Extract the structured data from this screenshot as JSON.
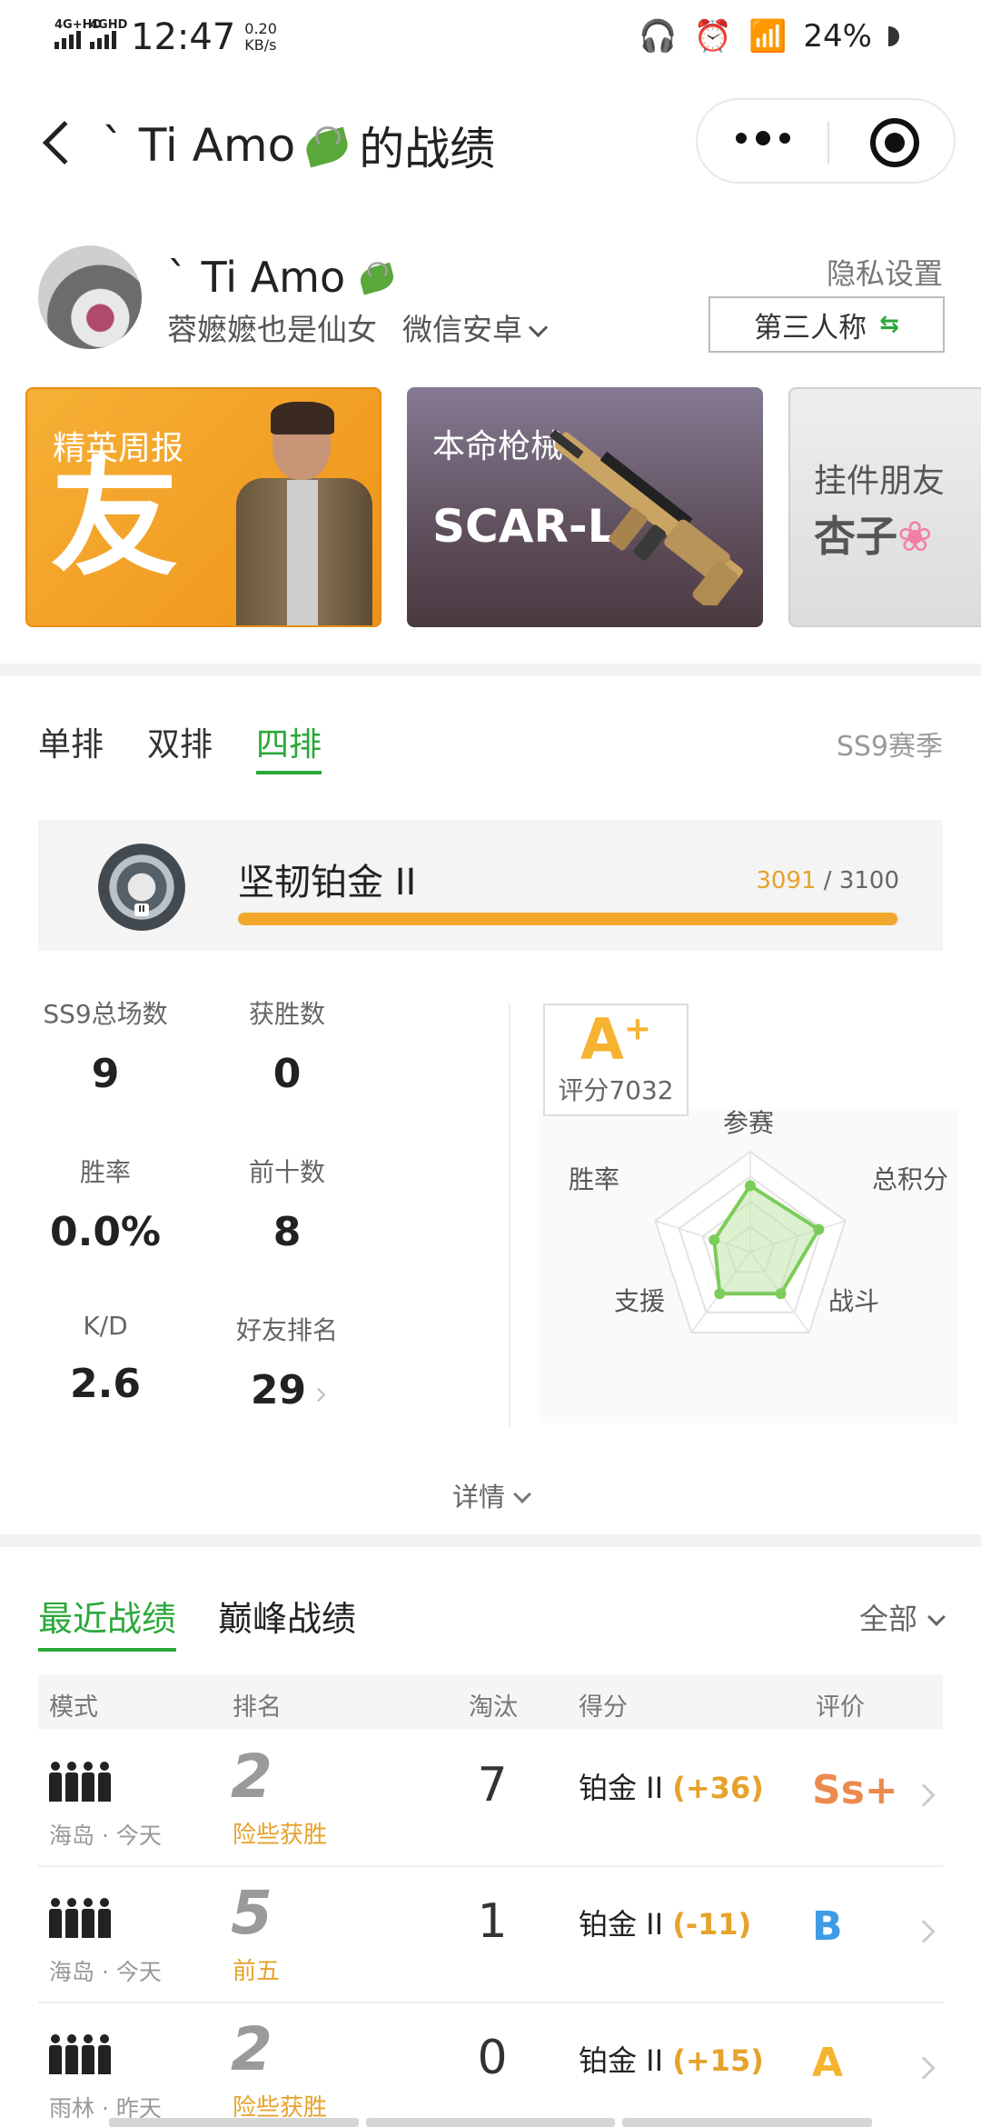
{
  "status_bar": {
    "network1": "4G+HD",
    "network2": "4GHD",
    "time": "12:47",
    "speed_value": "0.20",
    "speed_unit": "KB/s",
    "battery": "24%"
  },
  "nav": {
    "title": "` Ti Amo",
    "title_suffix": "的战绩"
  },
  "profile": {
    "name": "` Ti Amo",
    "signature": "蓉嬷嬷也是仙女",
    "platform": "微信安卓",
    "privacy_label": "隐私设置",
    "view_button": "第三人称"
  },
  "cards": [
    {
      "title": "精英周报",
      "value": "友"
    },
    {
      "title": "本命枪械",
      "value": "SCAR-L"
    },
    {
      "title": "挂件朋友",
      "value": "杏子"
    }
  ],
  "mode_tabs": [
    "单排",
    "双排",
    "四排"
  ],
  "active_mode": "四排",
  "season": "SS9赛季",
  "rank": {
    "name": "坚韧铂金 II",
    "current": "3091",
    "sep": " / ",
    "target": "3100",
    "progress": 0.997
  },
  "stats": [
    {
      "label": "SS9总场数",
      "value": "9"
    },
    {
      "label": "获胜数",
      "value": "0"
    },
    {
      "label": "胜率",
      "value": "0.0%"
    },
    {
      "label": "前十数",
      "value": "8"
    },
    {
      "label": "K/D",
      "value": "2.6"
    },
    {
      "label": "好友排名",
      "value": "29"
    }
  ],
  "grade": {
    "letter": "A",
    "plus": "+",
    "score_text": "评分7032"
  },
  "radar": {
    "labels": [
      "参赛",
      "总积分",
      "战斗",
      "支援",
      "胜率"
    ],
    "values": [
      0.66,
      0.72,
      0.52,
      0.52,
      0.38
    ],
    "colors": {
      "fill": "#bfe6a8",
      "stroke": "#7ccc5a",
      "grid": "#e2e2e2"
    }
  },
  "detail_label": "详情",
  "record_tabs": [
    "最近战绩",
    "巅峰战绩"
  ],
  "active_record_tab": "最近战绩",
  "filter_label": "全部",
  "table_headers": [
    "模式",
    "排名",
    "淘汰",
    "得分",
    "评价"
  ],
  "matches": [
    {
      "map_day": "海岛 · 今天",
      "rank": "2",
      "rank_tag": "险些获胜",
      "kills": "7",
      "tier": "铂金 II",
      "delta": "(+36)",
      "rating": "Ss+",
      "rating_color": "#ec8a4e"
    },
    {
      "map_day": "海岛 · 今天",
      "rank": "5",
      "rank_tag": "前五",
      "kills": "1",
      "tier": "铂金 II",
      "delta": "(-11)",
      "rating": "B",
      "rating_color": "#3e9be6"
    },
    {
      "map_day": "雨林 · 昨天",
      "rank": "2",
      "rank_tag": "险些获胜",
      "kills": "0",
      "tier": "铂金 II",
      "delta": "(+15)",
      "rating": "A",
      "rating_color": "#f5b330"
    }
  ],
  "colors": {
    "accent_green": "#2aa839",
    "accent_orange": "#e6a22a",
    "bar_orange": "#f2a72c"
  }
}
